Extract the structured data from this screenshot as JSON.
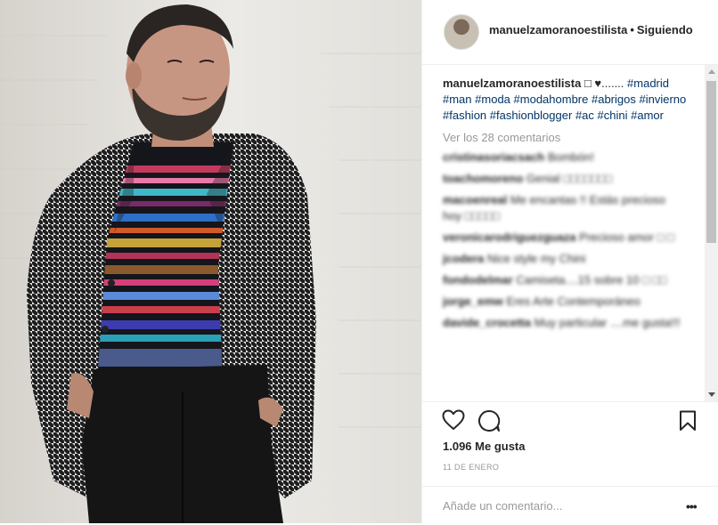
{
  "post": {
    "photo_alt": "",
    "header": {
      "username": "manuelzamoranoestilista",
      "separator": "•",
      "follow_label": "Siguiendo"
    },
    "caption": {
      "author": "manuelzamoranoestilista",
      "text": " □ ♥....... ",
      "hashtags": [
        "#madrid",
        "#man",
        "#moda",
        "#modahombre",
        "#abrigos",
        "#invierno",
        "#fashion",
        "#fashionblogger",
        "#ac",
        "#chini",
        "#amor"
      ]
    },
    "view_all_comments": "Ver los 28 comentarios",
    "comments": [
      {
        "user": "cristinasoriacsach",
        "text": "Bombón!"
      },
      {
        "user": "toachomoreno",
        "text": "Genial □□□□□□□"
      },
      {
        "user": "macoenreal",
        "text": "Me encantas !! Estás precioso hoy □□□□□"
      },
      {
        "user": "veronicarodriguezguaza",
        "text": "Precioso amor □ □"
      },
      {
        "user": "jcodera",
        "text": "Nice style my Chini"
      },
      {
        "user": "fondodelmar",
        "text": "Camiseta....15 sobre 10 □ □□"
      },
      {
        "user": "jorge_emw",
        "text": "Eres Arte Contemporáneo"
      },
      {
        "user": "davide_crocetta",
        "text": "Muy particular ....me gusta!!!"
      }
    ],
    "likes": "1.096 Me gusta",
    "date": "11 DE ENERO",
    "add_comment_placeholder": "Añade un comentario...",
    "icons": {
      "like": "heart-icon",
      "comment": "comment-bubble-icon",
      "save": "bookmark-icon",
      "more": "more-options-icon"
    },
    "colors": {
      "text": "#262626",
      "hashtag": "#003569",
      "secondary": "#999999",
      "border": "#efefef"
    }
  }
}
